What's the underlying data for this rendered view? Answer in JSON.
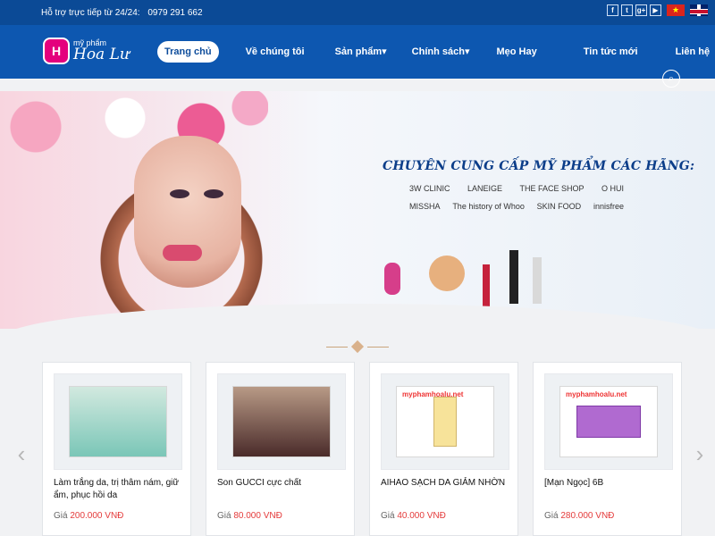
{
  "topbar": {
    "support_label": "Hỗ trợ trực tiếp từ 24/24:",
    "phone": "0979 291 662",
    "social": [
      "facebook-icon",
      "twitter-icon",
      "googleplus-icon",
      "youtube-icon"
    ],
    "languages": [
      "vi",
      "en"
    ]
  },
  "nav": {
    "logo_small": "mỹ phẩm",
    "logo_big": "Hoa Lư",
    "items": [
      {
        "label": "Trang chủ",
        "active": true
      },
      {
        "label": "Về chúng tôi"
      },
      {
        "label": "Sản phẩm",
        "has_dropdown": true
      },
      {
        "label": "Chính sách",
        "has_dropdown": true
      },
      {
        "label": "Mẹo Hay"
      },
      {
        "label": "Tin tức mới"
      },
      {
        "label": "Liên hệ"
      }
    ]
  },
  "banner": {
    "headline": "CHUYÊN CUNG CẤP MỸ PHẨM CÁC HÃNG:",
    "brands": [
      "3W CLINIC",
      "LANEIGE",
      "THE FACE SHOP",
      "O HUI",
      "MISSHA",
      "The history of Whoo",
      "SKIN FOOD",
      "innisfree"
    ]
  },
  "products": [
    {
      "name": "Làm trắng da, trị thâm nám, giữ ẩm, phục hồi da",
      "price_label": "Giá",
      "price": "200.000 VNĐ",
      "watermark": ""
    },
    {
      "name": "Son GUCCI cực chất",
      "price_label": "Giá",
      "price": "80.000 VNĐ",
      "watermark": ""
    },
    {
      "name": "AIHAO SẠCH DA GIẢM NHỜN",
      "price_label": "Giá",
      "price": "40.000 VNĐ",
      "watermark": "myphamhoalu.net"
    },
    {
      "name": "[Mạn Ngọc] 6B",
      "price_label": "Giá",
      "price": "280.000 VNĐ",
      "watermark": "myphamhoalu.net"
    }
  ]
}
